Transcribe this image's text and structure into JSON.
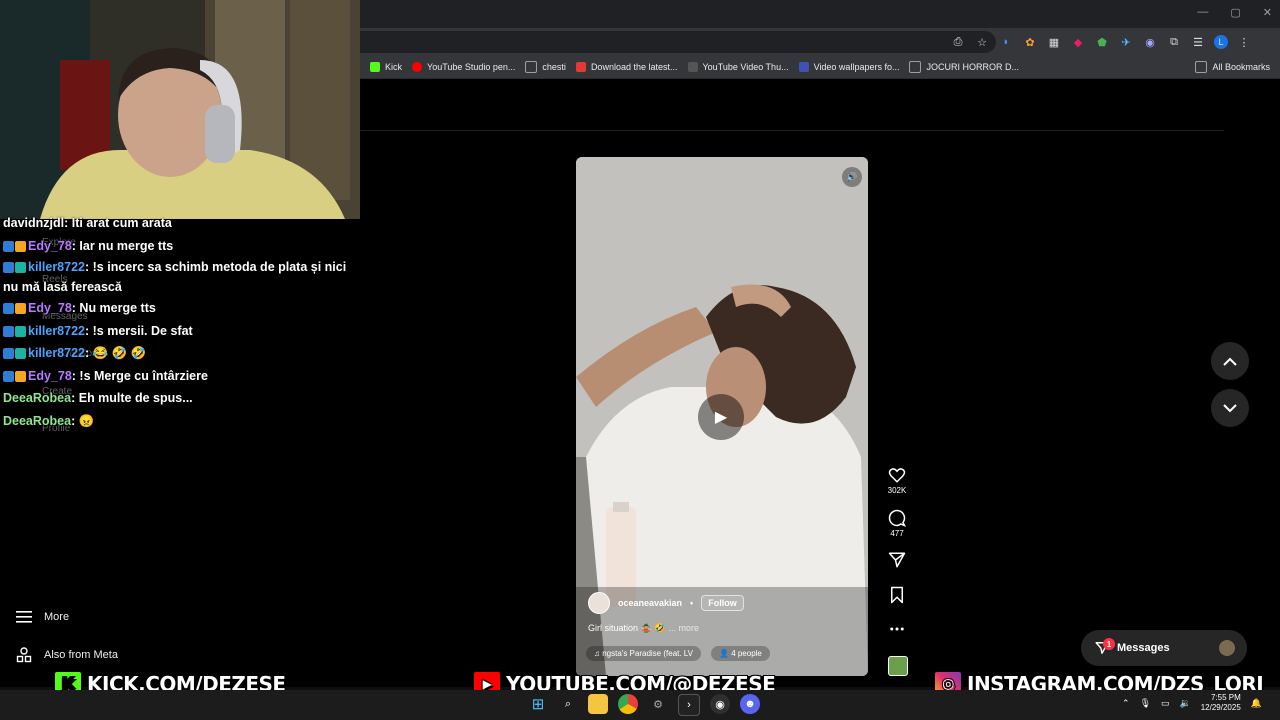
{
  "browser": {
    "window_controls": [
      "—",
      "▢",
      "✕"
    ],
    "bookmarks": [
      {
        "label": "Kick",
        "color": "#53fc18"
      },
      {
        "label": "YouTube Studio pen...",
        "color": "#ff0000"
      },
      {
        "label": "chesti",
        "color": "#9aa0a6"
      },
      {
        "label": "Download the latest...",
        "color": "#e53935"
      },
      {
        "label": "YouTube Video Thu...",
        "color": "#444"
      },
      {
        "label": "Video wallpapers fo...",
        "color": "#3f51b5"
      },
      {
        "label": "JOCURI HORROR D...",
        "color": "#9aa0a6"
      }
    ],
    "all_bookmarks": "All Bookmarks",
    "profile_initial": "L"
  },
  "chat": [
    {
      "user": "davidnzjdl",
      "color": "#ffffff",
      "badges": [],
      "msg": ": Iti arat cum arata"
    },
    {
      "user": "Edy_78",
      "color": "#b77bff",
      "badges": [
        "#2e7dd7",
        "#f5a623"
      ],
      "msg": ": Iar nu merge tts"
    },
    {
      "user": "killer8722",
      "color": "#4aa3ff",
      "badges": [
        "#2e7dd7",
        "#1bb3a2"
      ],
      "msg": ": !s incerc sa schimb metoda de plata și nici nu mă lasă ferească"
    },
    {
      "user": "Edy_78",
      "color": "#b77bff",
      "badges": [
        "#2e7dd7",
        "#f5a623"
      ],
      "msg": ": Nu merge tts"
    },
    {
      "user": "killer8722",
      "color": "#4aa3ff",
      "badges": [
        "#2e7dd7",
        "#1bb3a2"
      ],
      "msg": ": !s mersii. De sfat"
    },
    {
      "user": "killer8722",
      "color": "#4aa3ff",
      "badges": [
        "#2e7dd7",
        "#1bb3a2"
      ],
      "msg": ": 😂 🤣 🤣"
    },
    {
      "user": "Edy_78",
      "color": "#b77bff",
      "badges": [
        "#2e7dd7",
        "#f5a623"
      ],
      "msg": ": !s Merge cu întârziere"
    },
    {
      "user": "DeeaRobea",
      "color": "#8de88d",
      "badges": [],
      "msg": ": Eh multe de spus..."
    },
    {
      "user": "DeeaRobea",
      "color": "#8de88d",
      "badges": [],
      "msg": ": 😠"
    }
  ],
  "sidebar": {
    "ghost_items": [
      "Explore",
      "Reels",
      "Messages",
      "Creators",
      "Create",
      "Profile"
    ],
    "more": "More",
    "also_from_meta": "Also from Meta"
  },
  "reel": {
    "author": "oceaneavakian",
    "follow": "Follow",
    "caption": "Girl situation 🤹 🤣",
    "more": "... more",
    "audio": "ngsta's Paradise (feat. LV",
    "people": "4 people",
    "likes": "302K",
    "comments": "477"
  },
  "messages": {
    "label": "Messages",
    "badge": "1"
  },
  "banners": {
    "kick": "KICK.COM/DEZESE",
    "youtube": "YOUTUBE.COM/@DEZESE",
    "instagram": "INSTAGRAM.COM/DZS_LORI"
  },
  "taskbar": {
    "time": "7:55 PM",
    "date": "12/29/2025"
  }
}
